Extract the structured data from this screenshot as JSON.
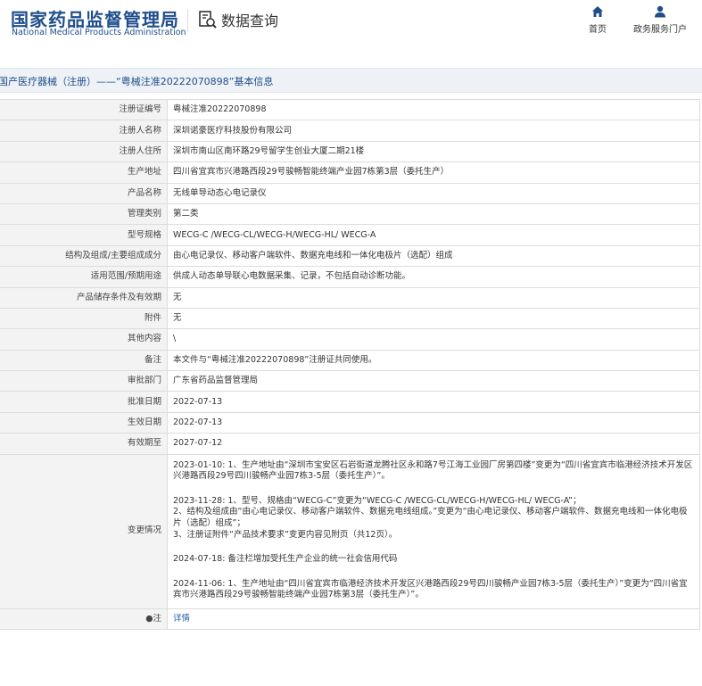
{
  "header": {
    "logo_cn": "国家药品监督管理局",
    "logo_en": "National Medical Products Administration",
    "query_title": "数据查询",
    "query_icon": "document-search-icon",
    "nav": [
      {
        "label": "首页",
        "icon": "home-icon"
      },
      {
        "label": "政务服务门户",
        "icon": "user-icon"
      }
    ]
  },
  "colors": {
    "brand": "#1f4e8c",
    "label_bg": "#f3f3f3",
    "title_bg": "#eef1f5"
  },
  "breadcrumb": "国产医疗器械（注册）——“粤械注准20222070898”基本信息",
  "rows": [
    {
      "label": "注册证编号",
      "value": "粤械注准20222070898"
    },
    {
      "label": "注册人名称",
      "value": "深圳诺豪医疗科技股份有限公司"
    },
    {
      "label": "注册人住所",
      "value": "深圳市南山区南环路29号留学生创业大厦二期21楼"
    },
    {
      "label": "生产地址",
      "value": "四川省宜宾市兴港路西段29号骏畅智能终端产业园7栋第3层（委托生产）"
    },
    {
      "label": "产品名称",
      "value": "无线单导动态心电记录仪"
    },
    {
      "label": "管理类别",
      "value": "第二类"
    },
    {
      "label": "型号规格",
      "value": "WECG-C /WECG-CL/WECG-H/WECG-HL/ WECG-A"
    },
    {
      "label": "结构及组成/主要组成成分",
      "value": "由心电记录仪、移动客户端软件、数据充电线和一体化电极片（选配）组成"
    },
    {
      "label": "适用范围/预期用途",
      "value": "供成人动态单导联心电数据采集、记录，不包括自动诊断功能。"
    },
    {
      "label": "产品储存条件及有效期",
      "value": "无"
    },
    {
      "label": "附件",
      "value": "无"
    },
    {
      "label": "其他内容",
      "value": "\\"
    },
    {
      "label": "备注",
      "value": "本文件与“粤械注准20222070898”注册证共同使用。"
    },
    {
      "label": "审批部门",
      "value": "广东省药品监督管理局"
    },
    {
      "label": "批准日期",
      "value": "2022-07-13"
    },
    {
      "label": "生效日期",
      "value": "2022-07-13"
    },
    {
      "label": "有效期至",
      "value": "2027-07-12"
    }
  ],
  "change": {
    "label": "变更情况",
    "entries": [
      [
        "2023-01-10: 1、生产地址由“深圳市宝安区石岩街道龙腾社区永和路7号江海工业园厂房第四楼”变更为“四川省宜宾市临港经济技术开发区兴港路西段29号四川骏畅产业园7栋3-5层（委托生产）”。"
      ],
      [
        "2023-11-28: 1、型号、规格由“WECG-C”变更为“WECG-C /WECG-CL/WECG-H/WECG-HL/ WECG-A”；",
        "2、结构及组成由“由心电记录仪、移动客户端软件、数据充电线组成。”变更为“由心电记录仪、移动客户端软件、数据充电线和一体化电极片（选配）组成”；",
        "3、注册证附件“产品技术要求”变更内容见附页（共12页）。"
      ],
      [
        "2024-07-18: 备注栏增加受托生产企业的统一社会信用代码"
      ],
      [
        "2024-11-06: 1、生产地址由“四川省宜宾市临港经济技术开发区兴港路西段29号四川骏畅产业园7栋3-5层（委托生产）”变更为“四川省宜宾市兴港路西段29号骏畅智能终端产业园7栋第3层（委托生产）”。"
      ]
    ]
  },
  "note": {
    "label": "●注",
    "link": "详情"
  }
}
